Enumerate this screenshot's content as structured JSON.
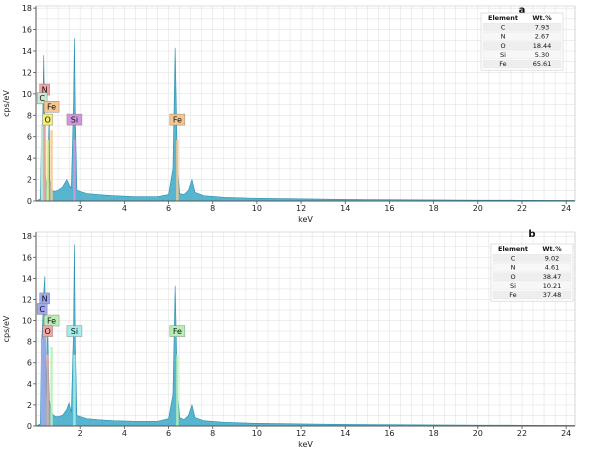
{
  "chart_data": [
    {
      "type": "area",
      "panel_label": "a",
      "xlabel": "keV",
      "ylabel": "cps/eV",
      "xlim": [
        0,
        24.4
      ],
      "ylim": [
        0,
        18.2
      ],
      "xticks": [
        2,
        4,
        6,
        8,
        10,
        12,
        14,
        16,
        18,
        20,
        22,
        24
      ],
      "yticks": [
        0,
        2,
        4,
        6,
        8,
        10,
        12,
        14,
        16,
        18
      ],
      "grid": true,
      "series": [
        {
          "color": "#3aa8c8",
          "x": [
            0.0,
            0.2,
            0.25,
            0.3,
            0.35,
            0.38,
            0.42,
            0.5,
            0.6,
            0.62,
            0.7,
            0.85,
            1.0,
            1.2,
            1.4,
            1.5,
            1.6,
            1.7,
            1.74,
            1.78,
            1.85,
            2.0,
            2.3,
            2.8,
            3.5,
            4.5,
            5.5,
            6.0,
            6.2,
            6.3,
            6.4,
            6.5,
            6.7,
            6.9,
            7.06,
            7.2,
            7.6,
            8.5,
            10,
            12,
            14,
            16,
            18,
            20,
            22,
            24.4
          ],
          "y": [
            0,
            0.2,
            6.4,
            7.2,
            13.6,
            9.0,
            2.5,
            1.0,
            8.0,
            2.0,
            1.0,
            0.9,
            1.0,
            1.3,
            2.0,
            1.5,
            1.2,
            9.0,
            15.2,
            8.0,
            1.0,
            0.9,
            0.7,
            0.6,
            0.5,
            0.4,
            0.4,
            0.6,
            3.0,
            14.3,
            3.5,
            0.7,
            0.6,
            1.0,
            2.0,
            0.8,
            0.5,
            0.35,
            0.25,
            0.2,
            0.15,
            0.12,
            0.1,
            0.08,
            0.07,
            0.05
          ]
        }
      ],
      "peak_labels": [
        {
          "text": "N",
          "x": 0.392,
          "y": 10.4,
          "color": "#f2a3a3"
        },
        {
          "text": "C",
          "x": 0.277,
          "y": 9.6,
          "color": "#c8ead0"
        },
        {
          "text": "Fe",
          "x": 0.705,
          "y": 8.8,
          "color": "#f6c690"
        },
        {
          "text": "O",
          "x": 0.525,
          "y": 7.6,
          "color": "#f5ee78"
        },
        {
          "text": "Si",
          "x": 1.74,
          "y": 7.6,
          "color": "#cf98dc"
        },
        {
          "text": "Fe",
          "x": 6.4,
          "y": 7.6,
          "color": "#f6c690"
        }
      ],
      "table": {
        "headers": [
          "Element",
          "Wt.%"
        ],
        "rows": [
          [
            "C",
            "7.93"
          ],
          [
            "N",
            "2.67"
          ],
          [
            "O",
            "18.44"
          ],
          [
            "Si",
            "5.30"
          ],
          [
            "Fe",
            "65.61"
          ]
        ]
      }
    },
    {
      "type": "area",
      "panel_label": "b",
      "xlabel": "keV",
      "ylabel": "cps/eV",
      "xlim": [
        0,
        24.4
      ],
      "ylim": [
        0,
        18.4
      ],
      "xticks": [
        2,
        4,
        6,
        8,
        10,
        12,
        14,
        16,
        18,
        20,
        22,
        24
      ],
      "yticks": [
        0,
        2,
        4,
        6,
        8,
        10,
        12,
        14,
        16,
        18
      ],
      "grid": true,
      "series": [
        {
          "color": "#3aa8c8",
          "x": [
            0.0,
            0.2,
            0.25,
            0.3,
            0.35,
            0.4,
            0.45,
            0.52,
            0.6,
            0.7,
            0.8,
            0.9,
            1.0,
            1.2,
            1.4,
            1.5,
            1.6,
            1.7,
            1.74,
            1.78,
            1.85,
            2.0,
            2.3,
            2.8,
            3.5,
            4.5,
            5.5,
            6.0,
            6.2,
            6.3,
            6.4,
            6.5,
            6.7,
            6.9,
            7.06,
            7.2,
            7.6,
            8.5,
            10,
            12,
            14,
            16,
            18,
            20,
            22,
            24.4
          ],
          "y": [
            0,
            0.2,
            7.8,
            9.8,
            12.6,
            14.2,
            3.0,
            10.4,
            2.5,
            1.3,
            1.0,
            0.9,
            0.9,
            1.0,
            1.6,
            2.2,
            1.3,
            9.0,
            17.2,
            8.0,
            1.0,
            0.9,
            0.7,
            0.6,
            0.5,
            0.45,
            0.45,
            0.7,
            3.0,
            13.3,
            3.5,
            0.8,
            0.6,
            1.0,
            2.0,
            0.8,
            0.5,
            0.35,
            0.25,
            0.2,
            0.15,
            0.12,
            0.1,
            0.08,
            0.07,
            0.05
          ]
        }
      ],
      "peak_labels": [
        {
          "text": "N",
          "x": 0.392,
          "y": 12.1,
          "color": "#9fa8ec"
        },
        {
          "text": "C",
          "x": 0.277,
          "y": 11.1,
          "color": "#9fa8ec"
        },
        {
          "text": "Fe",
          "x": 0.705,
          "y": 10.0,
          "color": "#b8eeb6"
        },
        {
          "text": "O",
          "x": 0.525,
          "y": 9.0,
          "color": "#f2a3a3"
        },
        {
          "text": "Si",
          "x": 1.74,
          "y": 9.0,
          "color": "#a4ecea"
        },
        {
          "text": "Fe",
          "x": 6.4,
          "y": 9.0,
          "color": "#b8eeb6"
        }
      ],
      "table": {
        "headers": [
          "Element",
          "Wt.%"
        ],
        "rows": [
          [
            "C",
            "9.02"
          ],
          [
            "N",
            "4.61"
          ],
          [
            "O",
            "38.47"
          ],
          [
            "Si",
            "10.21"
          ],
          [
            "Fe",
            "37.48"
          ]
        ]
      }
    }
  ]
}
